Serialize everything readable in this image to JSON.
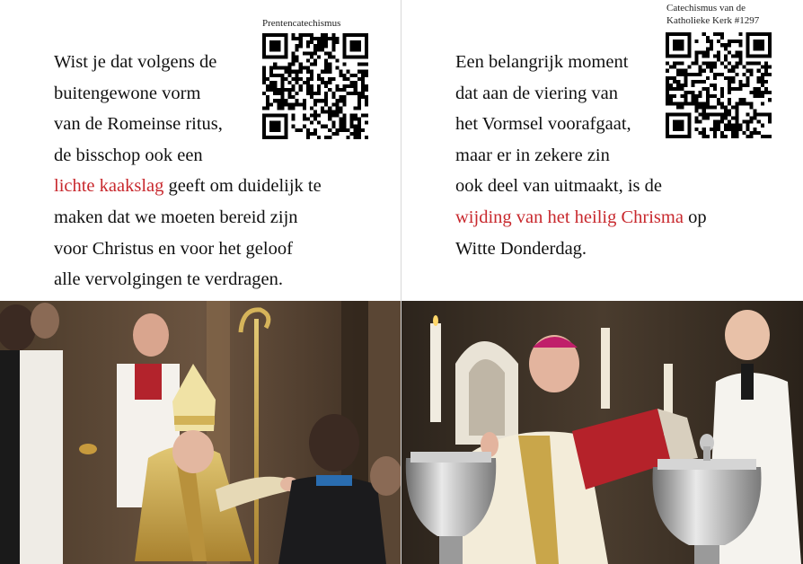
{
  "left_card": {
    "qr_caption": "Prentencatechismus",
    "lines_before": [
      "Wist je dat volgens de",
      "buitengewone vorm",
      "van de Romeinse ritus,",
      "de bisschop ook een"
    ],
    "highlight": "lichte kaakslag",
    "highlight_rest": " geeft om duidelijk te",
    "lines_after": [
      "maken dat we moeten bereid zijn",
      "voor Christus en voor het geloof",
      "alle vervolgingen te verdragen."
    ],
    "photo_label": "bishop-confirmation-photo"
  },
  "right_card": {
    "qr_caption_line1": "Catechismus van de",
    "qr_caption_line2": "Katholieke Kerk #1297",
    "lines_before": [
      "Een belangrijk moment",
      "dat aan de viering van",
      "het Vormsel voorafgaat,",
      "maar er in zekere zin",
      "ook deel van uitmaakt, is de"
    ],
    "highlight": "wijding van het heilig Chrisma",
    "highlight_rest": " op",
    "lines_after": [
      "Witte Donderdag."
    ],
    "photo_label": "chrism-blessing-photo"
  },
  "colors": {
    "highlight": "#c8282d",
    "text": "#111111"
  }
}
